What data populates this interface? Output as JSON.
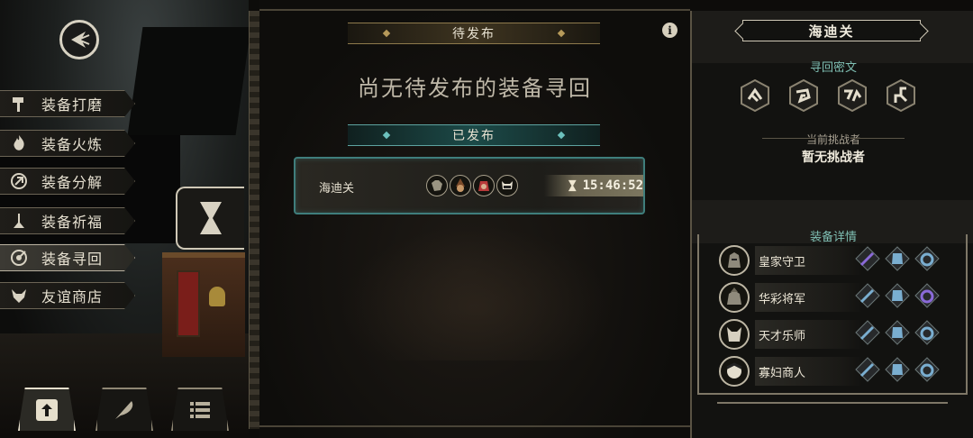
{
  "menu": {
    "items": [
      {
        "label": "装备打磨",
        "icon": "hammer-icon"
      },
      {
        "label": "装备火炼",
        "icon": "flame-icon"
      },
      {
        "label": "装备分解",
        "icon": "disassemble-icon"
      },
      {
        "label": "装备祈福",
        "icon": "pray-icon"
      },
      {
        "label": "装备寻回",
        "icon": "target-icon",
        "active": true
      },
      {
        "label": "友谊商店",
        "icon": "fox-shop-icon"
      }
    ]
  },
  "bottom_bar": {
    "buttons": [
      {
        "icon": "upload-icon",
        "active": true
      },
      {
        "icon": "feather-icon",
        "active": false
      },
      {
        "icon": "list-icon",
        "active": false
      }
    ]
  },
  "center": {
    "pending_header": "待发布",
    "empty_message": "尚无待发布的装备寻回",
    "published_header": "已发布",
    "info_icon_text": "i",
    "task": {
      "name": "海迪关",
      "timer": "15:46:52",
      "portraits": [
        "dog-portrait",
        "witch-portrait",
        "red-hood-portrait",
        "cat-portrait"
      ]
    }
  },
  "right": {
    "title": "海迪关",
    "cipher_header": "寻回密文",
    "cipher_glyphs": [
      "glyph-1",
      "glyph-2",
      "glyph-3",
      "glyph-4"
    ],
    "challenger_header": "当前挑战者",
    "challenger_value": "暂无挑战者",
    "equip_header": "装备详情",
    "equipment": [
      {
        "name": "皇家守卫",
        "slots": [
          "sword-icon",
          "armor-icon",
          "ring-icon"
        ],
        "sword_rare": true,
        "ring_rare": false
      },
      {
        "name": "华彩将军",
        "slots": [
          "sword-icon",
          "armor-icon",
          "ring-icon"
        ],
        "sword_rare": false,
        "ring_rare": true
      },
      {
        "name": "天才乐师",
        "slots": [
          "sword-icon",
          "armor-icon",
          "ring-icon"
        ],
        "sword_rare": false,
        "ring_rare": false
      },
      {
        "name": "寡妇商人",
        "slots": [
          "sword-icon",
          "armor-icon",
          "ring-icon"
        ],
        "sword_rare": false,
        "ring_rare": false
      }
    ]
  },
  "colors": {
    "teal_accent": "#5da3a0",
    "gold_accent": "#8e7a4c",
    "rare_purple": "#8a6ad8",
    "common_blue": "#7aaed0"
  }
}
